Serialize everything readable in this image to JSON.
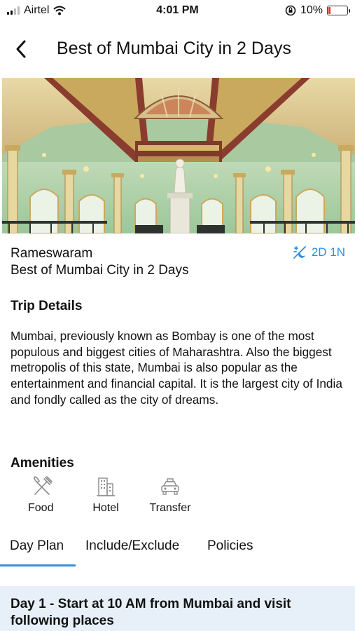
{
  "status_bar": {
    "carrier": "Airtel",
    "time": "4:01 PM",
    "battery_text": "10%",
    "battery_level": 0.1,
    "battery_color": "#e0302a",
    "icons": [
      "signal-icon",
      "wifi-icon",
      "orientation-lock-icon",
      "battery-icon"
    ]
  },
  "nav": {
    "back_icon": "chevron-left-icon",
    "title": "Best of Mumbai City in 2 Days"
  },
  "hero": {
    "image_desc": "ornate hall interior"
  },
  "package": {
    "location": "Rameswaram",
    "name": "Best of Mumbai City in 2 Days",
    "duration": "2D 1N",
    "duration_icon": "day-night-icon",
    "accent_color": "#2d8fe0"
  },
  "trip_details": {
    "heading": "Trip Details",
    "description": "Mumbai, previously known as Bombay is one of the most populous and biggest cities of Maharashtra. Also the biggest metropolis of this state, Mumbai is also popular as the entertainment and financial capital. It is the largest city of India and fondly called as the city of dreams."
  },
  "amenities": {
    "heading": "Amenities",
    "items": [
      {
        "label": "Food",
        "icon": "fork-knife-icon"
      },
      {
        "label": "Hotel",
        "icon": "building-icon"
      },
      {
        "label": "Transfer",
        "icon": "car-icon"
      }
    ]
  },
  "tabs": {
    "items": [
      {
        "label": "Day Plan"
      },
      {
        "label": "Include/Exclude"
      },
      {
        "label": "Policies"
      }
    ],
    "active_color": "#3b8fd9"
  },
  "day_plan": {
    "title": "Day 1 - Start at 10 AM from Mumbai and visit following places"
  }
}
